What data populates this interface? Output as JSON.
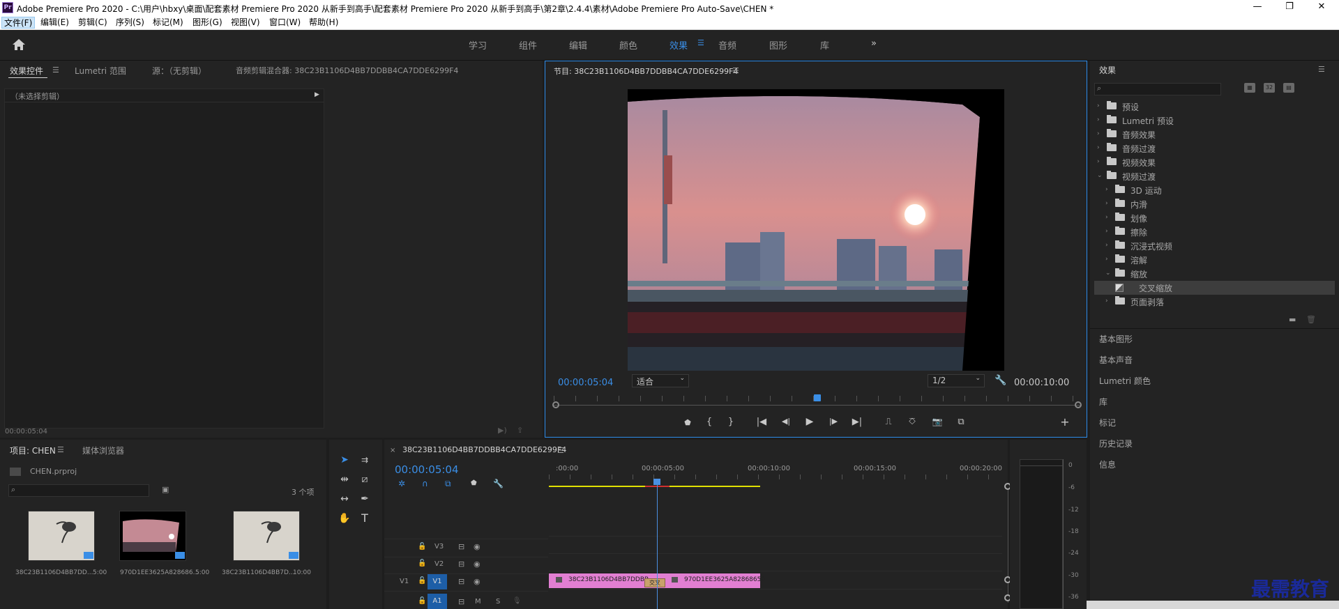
{
  "window": {
    "app_icon": "Pr",
    "title": "Adobe Premiere Pro 2020 - C:\\用户\\hbxy\\桌面\\配套素材 Premiere Pro 2020 从新手到高手\\配套素材 Premiere Pro 2020 从新手到高手\\第2章\\2.4.4\\素材\\Adobe Premiere Pro Auto-Save\\CHEN *",
    "controls": [
      "—",
      "❐",
      "✕"
    ]
  },
  "menu": [
    "文件(F)",
    "编辑(E)",
    "剪辑(C)",
    "序列(S)",
    "标记(M)",
    "图形(G)",
    "视图(V)",
    "窗口(W)",
    "帮助(H)"
  ],
  "workspaces": {
    "items": [
      "学习",
      "组件",
      "编辑",
      "颜色",
      "效果",
      "音频",
      "图形",
      "库"
    ],
    "active": "效果",
    "more": "»"
  },
  "source_panel": {
    "tabs": [
      "效果控件",
      "Lumetri 范围",
      "源：（无剪辑）",
      "音频剪辑混合器: 38C23B1106D4BB7DDBB4CA7DDE6299F4"
    ],
    "no_clip": "（未选择剪辑）",
    "timecode": "00:00:05:04"
  },
  "program_monitor": {
    "title": "节目: 38C23B1106D4BB7DDBB4CA7DDE6299F4",
    "timecode": "00:00:05:04",
    "fit": "适合",
    "resolution": "1/2",
    "duration": "00:00:10:00",
    "playhead_fraction": 0.5
  },
  "effects_panel": {
    "title": "效果",
    "tree": [
      {
        "label": "预设",
        "level": 0,
        "open": false,
        "icon": "preset-folder"
      },
      {
        "label": "Lumetri 预设",
        "level": 0,
        "open": false,
        "icon": "preset-folder"
      },
      {
        "label": "音频效果",
        "level": 0,
        "open": false,
        "icon": "folder"
      },
      {
        "label": "音频过渡",
        "level": 0,
        "open": false,
        "icon": "folder"
      },
      {
        "label": "视频效果",
        "level": 0,
        "open": false,
        "icon": "folder"
      },
      {
        "label": "视频过渡",
        "level": 0,
        "open": true,
        "icon": "folder"
      },
      {
        "label": "3D 运动",
        "level": 1,
        "open": false,
        "icon": "folder"
      },
      {
        "label": "内滑",
        "level": 1,
        "open": false,
        "icon": "folder"
      },
      {
        "label": "划像",
        "level": 1,
        "open": false,
        "icon": "folder"
      },
      {
        "label": "擦除",
        "level": 1,
        "open": false,
        "icon": "folder"
      },
      {
        "label": "沉浸式视频",
        "level": 1,
        "open": false,
        "icon": "folder"
      },
      {
        "label": "溶解",
        "level": 1,
        "open": false,
        "icon": "folder"
      },
      {
        "label": "缩放",
        "level": 1,
        "open": true,
        "icon": "folder"
      },
      {
        "label": "交叉缩放",
        "level": 2,
        "open": false,
        "icon": "transition",
        "selected": true
      },
      {
        "label": "页面剥落",
        "level": 1,
        "open": false,
        "icon": "folder"
      }
    ],
    "sections": [
      "基本图形",
      "基本声音",
      "Lumetri 颜色",
      "库",
      "标记",
      "历史记录",
      "信息"
    ]
  },
  "project_panel": {
    "tabs": [
      "项目: CHEN",
      "媒体浏览器"
    ],
    "file": "CHEN.prproj",
    "count": "3 个项",
    "items": [
      {
        "name": "38C23B1106D4BB7DD...",
        "dur": "5:00"
      },
      {
        "name": "970D1EE3625A828686...",
        "dur": "5:00"
      },
      {
        "name": "38C23B1106D4BB7D...",
        "dur": "10:00"
      }
    ]
  },
  "timeline": {
    "close": "×",
    "title": "38C23B1106D4BB7DDBB4CA7DDE6299F4",
    "timecode": "00:00:05:04",
    "ruler": [
      ":00:00",
      "00:00:05:00",
      "00:00:10:00",
      "00:00:15:00",
      "00:00:20:00"
    ],
    "tracks": [
      {
        "label": "V3",
        "toggle": "",
        "m": "",
        "s": ""
      },
      {
        "label": "V2",
        "toggle": "",
        "m": "",
        "s": ""
      },
      {
        "label": "V1",
        "toggle": "V1",
        "m": "",
        "s": ""
      },
      {
        "label": "",
        "toggle": "A1",
        "m": "M",
        "s": "S"
      }
    ],
    "clips": [
      {
        "name": "38C23B1106D4BB7DDBB",
        "track": "V1"
      },
      {
        "name": "970D1EE3625A82868650",
        "track": "V1"
      }
    ],
    "transition_label": "交叉",
    "colors": {
      "clip": "#e27fd2",
      "playhead": "#4a90e2",
      "work_area": "#e0e000"
    }
  },
  "audio_meter": {
    "ticks": [
      "0",
      "-6",
      "-12",
      "-18",
      "-24",
      "-30",
      "-36"
    ]
  },
  "watermark": "最需教育"
}
